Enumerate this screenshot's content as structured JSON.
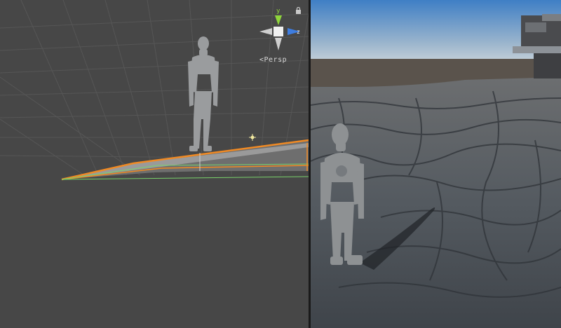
{
  "scene_view": {
    "projection_label": "<Persp",
    "gizmo": {
      "y_label": "y",
      "z_label": "z"
    },
    "colors": {
      "background": "#474747",
      "grid": "#5a5a5a",
      "selection": "#f08a24",
      "collider": "#7ad36b"
    }
  },
  "game_view": {
    "colors": {
      "sky_top": "#3f7fc5",
      "sky_bottom": "#b8c7d4",
      "ground": "#4e545a",
      "character": "#8e9193"
    }
  }
}
